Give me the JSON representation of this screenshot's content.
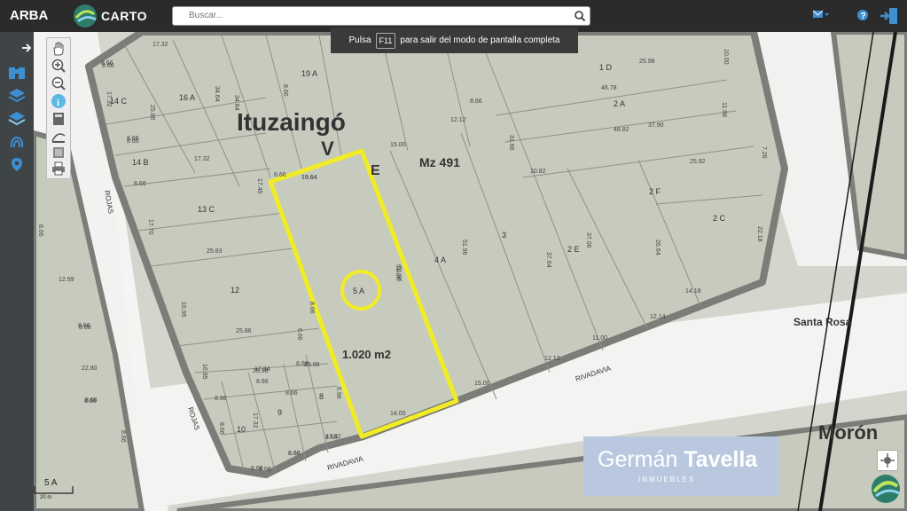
{
  "topbar": {
    "arba_label": "ARBA",
    "carto_label": "CARTO",
    "search_placeholder": "Buscar...",
    "icons": [
      "search-icon",
      "mail-icon",
      "help-icon",
      "login-icon"
    ]
  },
  "fullscreen_notice": {
    "before": "Pulsa",
    "key": "F11",
    "after": "para salir del modo de pantalla completa"
  },
  "sidebar_icons": [
    "arrow-right-icon",
    "binoculars-icon",
    "layers-icon",
    "layers-alt-icon",
    "fingerprint-icon",
    "map-marker-icon"
  ],
  "tool_icons": [
    "pan-hand-icon",
    "zoom-in-icon",
    "zoom-out-icon",
    "info-icon",
    "calculator-icon",
    "measure-icon",
    "layers-tool-icon",
    "print-icon"
  ],
  "map": {
    "place_ituzaingo": "Ituzaingó",
    "place_v": "V",
    "place_e": "E",
    "block": "Mz 491",
    "parcel_highlight": "5 A",
    "area": "1.020 m2",
    "place_santa_rosa": "Santa Rosa",
    "place_moron": "Morón",
    "streets": {
      "rojas_1": "ROJAS",
      "rojas_2": "ROJAS",
      "rivadavia_1": "RIVADAVIA",
      "rivadavia_2": "RIVADAVIA"
    },
    "parcels": [
      "19 A",
      "16 A",
      "14 C",
      "14 B",
      "13 C",
      "12",
      "10",
      "9",
      "8",
      "4 A",
      "3",
      "2 E",
      "2 A",
      "2 F",
      "2 C",
      "1 D"
    ],
    "measures": [
      "17.32",
      "8.66",
      "17.32",
      "25.86",
      "34.64",
      "34.64",
      "8.66",
      "8.66",
      "8.66",
      "12.12",
      "15.00",
      "48.82",
      "37.90",
      "46.78",
      "25.98",
      "10.00",
      "11.08",
      "25.92",
      "10.82",
      "7.26",
      "17.32",
      "17.45",
      "8.66",
      "19.64",
      "19.64",
      "51.96",
      "51.96",
      "31.96",
      "37.64",
      "37.06",
      "26.64",
      "22.18",
      "14.18",
      "12.14",
      "11.00",
      "12.12",
      "15.00",
      "8.66",
      "8.66",
      "8.66",
      "25.98",
      "25.83",
      "25.86",
      "16.95",
      "17.70",
      "16.95",
      "8.66",
      "8.66",
      "8.66",
      "8.66",
      "8.66",
      "17.32",
      "17.32",
      "8.66",
      "8.66",
      "12.99",
      "8.66",
      "8.66",
      "22.80",
      "8.66",
      "8.66",
      "8.66",
      "8.66",
      "6.96",
      "17.34",
      "25.98",
      "8.66",
      "8.66",
      "8.66",
      "8.66",
      "14.00",
      "51.96",
      "6.66"
    ]
  },
  "branding": {
    "first": "Germán",
    "last": "Tavella",
    "sub": "INMUEBLES"
  },
  "scale": {
    "label": "5 A",
    "sub": "20 m"
  }
}
